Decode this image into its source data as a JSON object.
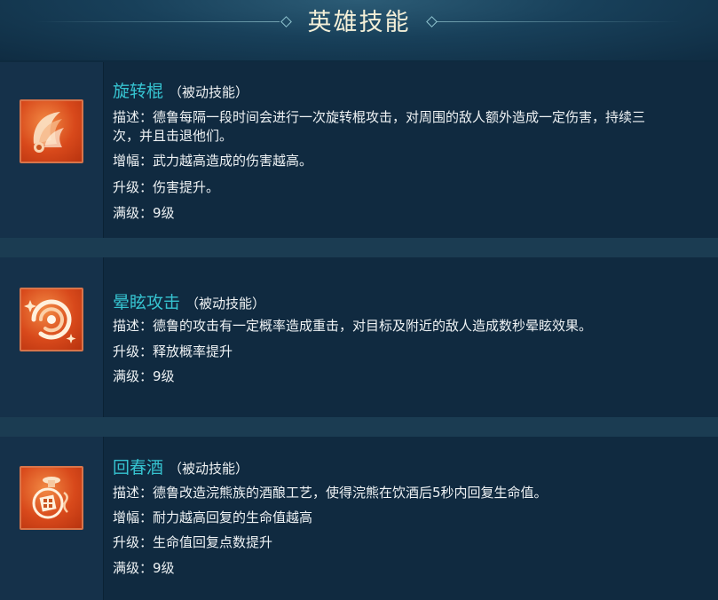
{
  "page_title": "英雄技能",
  "skills": [
    {
      "name": "旋转棍",
      "type": "（被动技能）",
      "icon": "spinning-staff-icon",
      "lines": [
        "描述：德鲁每隔一段时间会进行一次旋转棍攻击，对周围的敌人额外造成一定伤害，持续三",
        "次，并且击退他们。",
        "增幅：武力越高造成的伤害越高。",
        "升级：伤害提升。",
        "满级：9级"
      ]
    },
    {
      "name": "晕眩攻击",
      "type": "（被动技能）",
      "icon": "swirl-stun-icon",
      "lines": [
        "描述：德鲁的攻击有一定概率造成重击，对目标及附近的敌人造成数秒晕眩效果。",
        "升级：释放概率提升",
        "满级：9级"
      ]
    },
    {
      "name": "回春酒",
      "type": "（被动技能）",
      "icon": "wine-gourd-icon",
      "lines": [
        "描述：德鲁改造浣熊族的酒酿工艺，使得浣熊在饮酒后5秒内回复生命值。",
        "增幅：耐力越高回复的生命值越高",
        "升级：生命值回复点数提升",
        "满级：9级"
      ]
    }
  ],
  "colors": {
    "skill_name": "#36c3d0",
    "icon_bg": "#d8491b",
    "panel_bg": "#102a40"
  }
}
